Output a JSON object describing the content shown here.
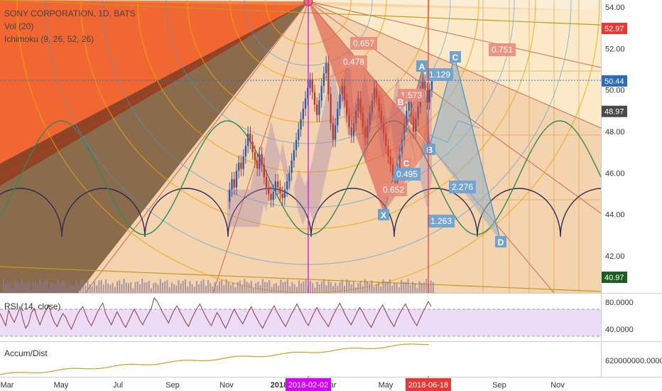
{
  "legend": {
    "title": "SONY CORPORATION, 1D, BATS",
    "volume": "Vol (20)",
    "ichimoku": "Ichimoku (9, 26, 52, 26)"
  },
  "price_axis": {
    "ticks": [
      "54.00",
      "52.00",
      "50.00",
      "48.00",
      "46.00",
      "44.00",
      "42.00"
    ],
    "badges": [
      {
        "text": "52.97",
        "color": "#e53935"
      },
      {
        "text": "50.44",
        "color": "#2e6db4"
      },
      {
        "text": "48.97",
        "color": "#4a4a4a"
      },
      {
        "text": "40.97",
        "color": "#1b5e20"
      }
    ]
  },
  "rsi": {
    "label": "RSI (14, close)",
    "ticks": [
      "80.0000",
      "40.0000"
    ],
    "range": [
      30,
      85
    ],
    "values": [
      62,
      55,
      48,
      66,
      58,
      52,
      60,
      70,
      55,
      45,
      50,
      63,
      68,
      57,
      49,
      58,
      65,
      72,
      60,
      52,
      47,
      55,
      62,
      58,
      50,
      44,
      52,
      60,
      66,
      70,
      61,
      53,
      48,
      55,
      63,
      69,
      74,
      62,
      55,
      49,
      57,
      64,
      58,
      51,
      46,
      53,
      60,
      67,
      61,
      54,
      49,
      56,
      62,
      68,
      80,
      76,
      70,
      63,
      57,
      51,
      59,
      66,
      71,
      64,
      58,
      52,
      47,
      55,
      62,
      68,
      73,
      66,
      59,
      53,
      48,
      56,
      63,
      58,
      51,
      45,
      52,
      60,
      67,
      61,
      55,
      50,
      57,
      64,
      70,
      62,
      56,
      50,
      45,
      52,
      59,
      65,
      71,
      64,
      58,
      52,
      47,
      54,
      61,
      67,
      73,
      66,
      60,
      53,
      48,
      56,
      63,
      69,
      62,
      57,
      52,
      47,
      55,
      62,
      68,
      74,
      67,
      60,
      54,
      49,
      56,
      63,
      69,
      64,
      57,
      51,
      46,
      53,
      60,
      66,
      72,
      65,
      58,
      52,
      47,
      55,
      62,
      68,
      73,
      66,
      59,
      53,
      48,
      56,
      63,
      69,
      76,
      70
    ]
  },
  "accum_dist": {
    "label": "Accum/Dist",
    "tick": "620000000.0000"
  },
  "time_axis": {
    "labels": [
      "Mar",
      "May",
      "Jul",
      "Sep",
      "Nov",
      "2018",
      "Mar",
      "May",
      "Sep",
      "Nov"
    ],
    "markers": [
      {
        "text": "2018-02-02",
        "color": "#d500f9"
      },
      {
        "text": "2018-06-18",
        "color": "#e53935"
      }
    ]
  },
  "annotations": {
    "fib_levels": [
      "0.657",
      "0.751",
      "0.478",
      "1.129",
      "1.573",
      "0.495",
      "0.652",
      "2.276",
      "1.263"
    ],
    "pattern_points": [
      "A",
      "B",
      "C",
      "D",
      "X",
      "B",
      "C"
    ]
  },
  "chart_data": {
    "type": "line",
    "title": "SONY CORPORATION, 1D, BATS",
    "ylim": [
      40.5,
      54.3
    ],
    "close": [
      44.6,
      45.2,
      45.7,
      45.3,
      46.1,
      46.5,
      46.2,
      46.8,
      47.3,
      47.9,
      47.5,
      47.0,
      46.6,
      46.2,
      46.9,
      46.4,
      45.8,
      45.3,
      45.0,
      44.7,
      45.1,
      45.6,
      45.3,
      45.0,
      44.8,
      45.2,
      45.6,
      46.0,
      46.6,
      47.1,
      47.6,
      48.1,
      48.6,
      49.1,
      49.6,
      50.1,
      50.5,
      49.9,
      49.3,
      48.8,
      49.5,
      50.2,
      50.8,
      51.3,
      49.8,
      48.4,
      47.6,
      48.3,
      49.1,
      49.8,
      50.2,
      49.5,
      48.8,
      48.2,
      47.8,
      48.4,
      49.0,
      49.6,
      48.9,
      48.2,
      47.7,
      48.3,
      48.9,
      49.5,
      50.1,
      49.6,
      49.0,
      48.4,
      47.9,
      47.3,
      46.8,
      46.4,
      45.9,
      45.5,
      46.2,
      46.9,
      47.6,
      48.3,
      49.0,
      49.6,
      48.7,
      48.0,
      48.6,
      49.2,
      49.9,
      50.4,
      50.0,
      49.4,
      50.0,
      50.44
    ],
    "volume_label": "Vol (20)",
    "rsi_ticks": [
      80,
      40
    ]
  }
}
